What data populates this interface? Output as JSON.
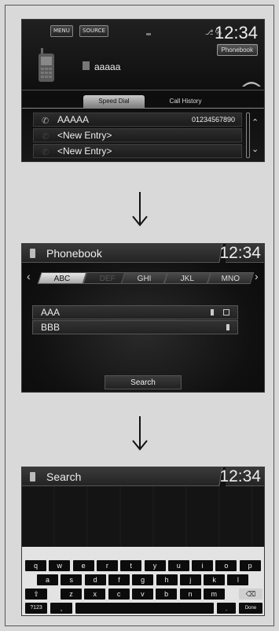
{
  "screen1": {
    "menu_label": "MENU",
    "source_label": "SOURCE",
    "status": "⎇ ℅",
    "clock": "12:34",
    "phonebook_btn": "Phonebook",
    "contact_name": "aaaaa",
    "tabs": [
      "Speed Dial",
      "Call History"
    ],
    "rows": [
      {
        "label": "AAAAA",
        "number": "01234567890"
      },
      {
        "label": "<New Entry>",
        "number": ""
      },
      {
        "label": "<New Entry>",
        "number": ""
      }
    ]
  },
  "screen2": {
    "title": "Phonebook",
    "clock": "12:34",
    "tabs": [
      "ABC",
      "DEF",
      "GHI",
      "JKL",
      "MNO"
    ],
    "rows": [
      "AAA",
      "BBB"
    ],
    "search_label": "Search"
  },
  "screen3": {
    "title": "Search",
    "clock": "12:34",
    "row1": [
      "q",
      "w",
      "e",
      "r",
      "t",
      "y",
      "u",
      "i",
      "o",
      "p"
    ],
    "row2": [
      "a",
      "s",
      "d",
      "f",
      "g",
      "h",
      "j",
      "k",
      "l"
    ],
    "row3": [
      "z",
      "x",
      "c",
      "v",
      "b",
      "n",
      "m"
    ],
    "shift_label": "⇧",
    "backspace_label": "⌫",
    "num_label": "?123",
    "comma_label": ",",
    "period_label": ".",
    "done_label": "Done"
  },
  "colors": {
    "background": "#d9d9d9",
    "screen": "#151515",
    "active_tab": "#d0d0d0"
  }
}
